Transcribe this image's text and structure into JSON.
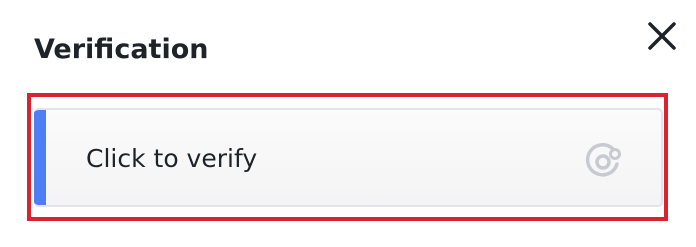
{
  "dialog": {
    "title": "Verification",
    "close_icon": "close-icon"
  },
  "verify": {
    "label": "Click to verify",
    "icon": "captcha-refresh-icon",
    "accent_color": "#4f7df3",
    "highlight_color": "#d9232e"
  }
}
